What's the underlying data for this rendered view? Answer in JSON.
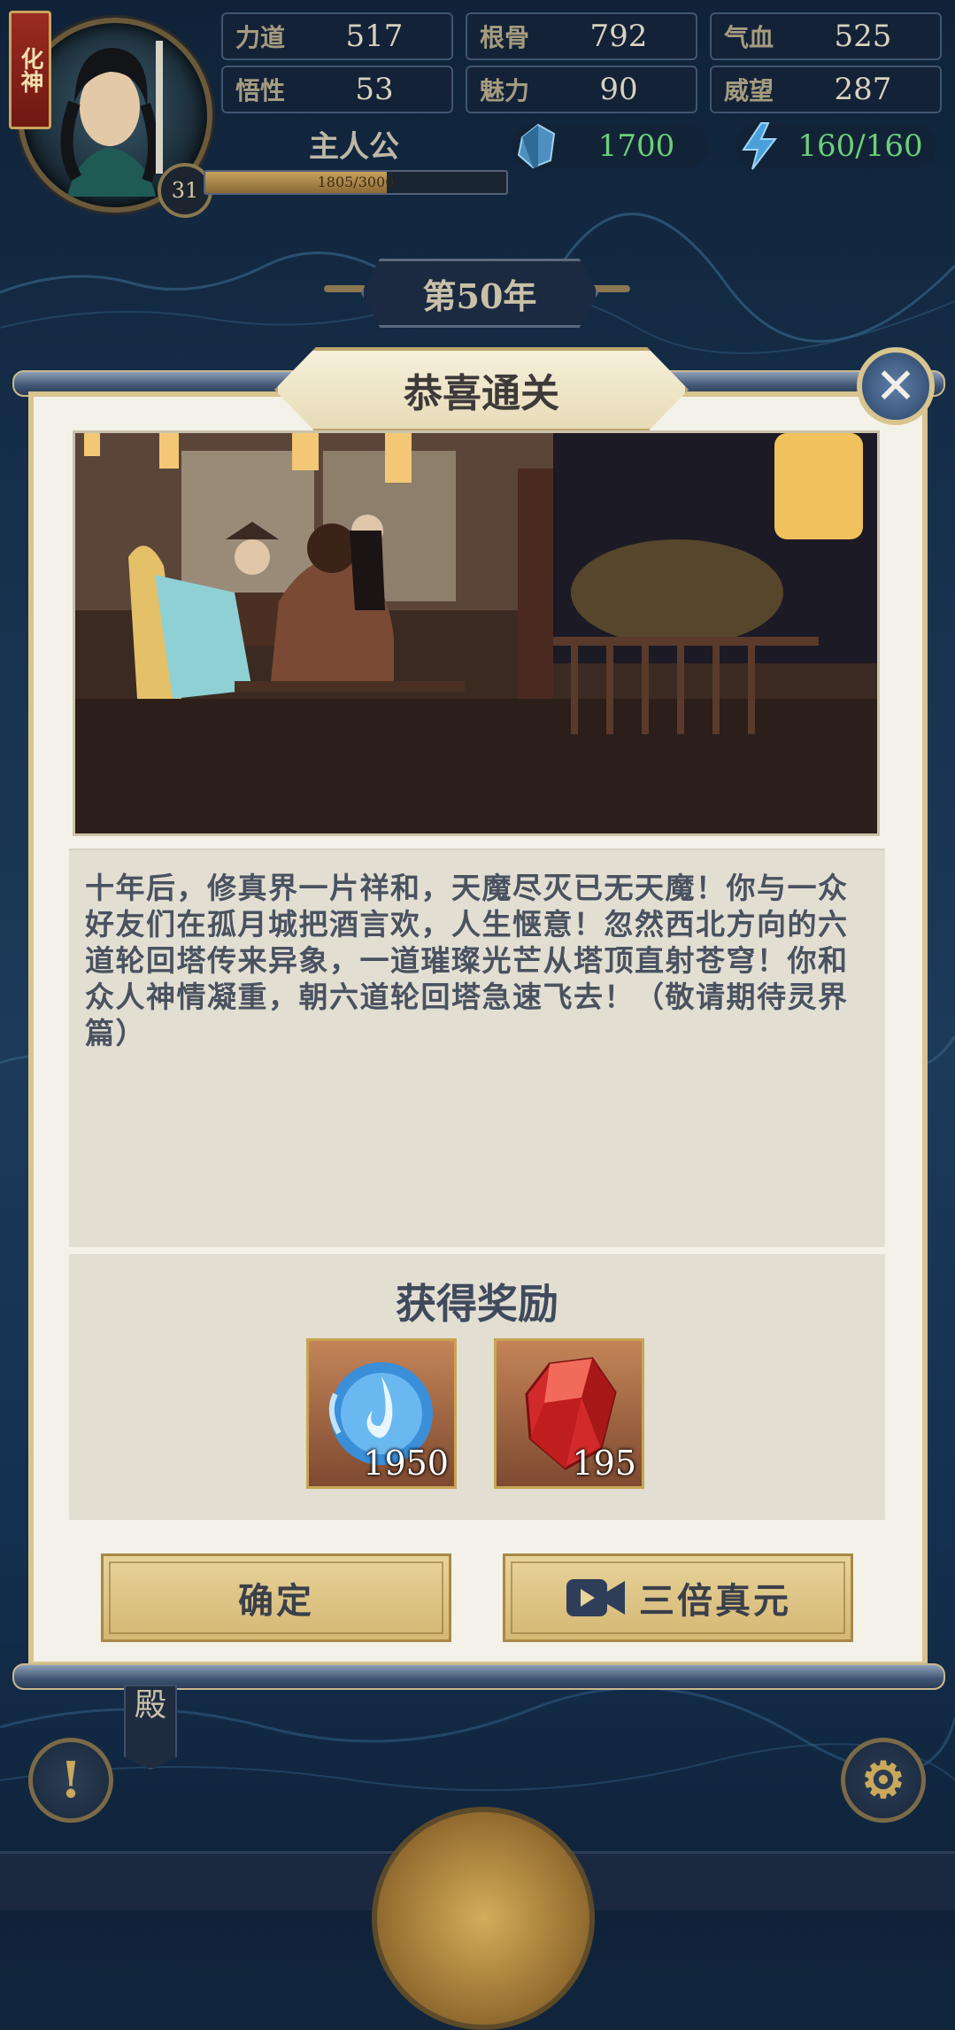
{
  "hud": {
    "rank": "化神",
    "level": "31",
    "player_name": "主人公",
    "xp_text": "1805/3000",
    "xp_progress": 0.6017,
    "stats": [
      {
        "label": "力道",
        "value": "517"
      },
      {
        "label": "根骨",
        "value": "792"
      },
      {
        "label": "气血",
        "value": "525"
      },
      {
        "label": "悟性",
        "value": "53"
      },
      {
        "label": "魅力",
        "value": "90"
      },
      {
        "label": "威望",
        "value": "287"
      }
    ],
    "crystals": "1700",
    "energy": "160/160"
  },
  "year_banner": "第50年",
  "dialog": {
    "title": "恭喜通关",
    "close_icon": "close-icon",
    "story": "十年后，修真界一片祥和，天魔尽灭已无天魔！你与一众好友们在孤月城把酒言欢，人生惬意！忽然西北方向的六道轮回塔传来异象，一道璀璨光芒从塔顶直射苍穹！你和众人神情凝重，朝六道轮回塔急速飞去！（敬请期待灵界篇）",
    "rewards_title": "获得奖励",
    "rewards": [
      {
        "icon": "blue-flame-orb-icon",
        "count": "1950"
      },
      {
        "icon": "red-crystal-icon",
        "count": "195"
      }
    ],
    "confirm_label": "确定",
    "triple_label": "三倍真元"
  },
  "bottom": {
    "hall_label": "殿"
  },
  "colors": {
    "crystal_text": "#6ccf7a",
    "panel_bg": "#f4f1e8",
    "button_gold": "#d4b774"
  }
}
